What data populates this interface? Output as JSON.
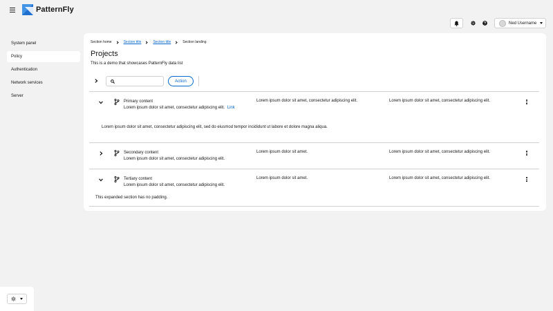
{
  "brand": {
    "name": "PatternFly"
  },
  "header": {
    "user_name": "Ned Username"
  },
  "sidebar": {
    "items": [
      {
        "label": "System panel"
      },
      {
        "label": "Policy"
      },
      {
        "label": "Authentication"
      },
      {
        "label": "Network services"
      },
      {
        "label": "Server"
      }
    ]
  },
  "breadcrumb": {
    "items": [
      {
        "label": "Section home"
      },
      {
        "label": "Section title"
      },
      {
        "label": "Section title"
      },
      {
        "label": "Section landing"
      }
    ]
  },
  "page": {
    "title": "Projects",
    "description": "This is a demo that showcases PatternFly data list"
  },
  "toolbar": {
    "search_placeholder": "",
    "action_label": "Action"
  },
  "rows": [
    {
      "title": "Primary content",
      "subtitle": "Lorem ipsum dolor sit amet, consectetur adipiscing elit.",
      "link": "Link",
      "col2": "Lorem ipsum dolor sit amet, consectetur adipiscing elit.",
      "col3": "Lorem ipsum dolor sit amet, consectetur adipiscing elit.",
      "expanded": "Lorem ipsum dolor sit amet, consectetur adipiscing elit, sed do eiusmod tempor incididunt ut labore et dolore magna aliqua."
    },
    {
      "title": "Secondary content",
      "subtitle": "Lorem ipsum dolor sit amet, consectetur adipiscing elit.",
      "col2": "Lorem ipsum dolor sit amet.",
      "col3": "Lorem ipsum dolor sit amet, consectetur adipiscing elit."
    },
    {
      "title": "Tertiary content",
      "subtitle": "Lorem ipsum dolor sit amet, consectetur adipiscing elit.",
      "col2": "Lorem ipsum dolor sit amet.",
      "col3": "Lorem ipsum dolor sit amet, consectetur adipiscing elit.",
      "expanded": "This expanded section has no padding."
    }
  ],
  "colors": {
    "accent": "#0066cc",
    "background": "#f2f2f2",
    "surface": "#ffffff",
    "border": "#d2d2d2"
  },
  "icons": [
    "menu-icon",
    "bell-icon",
    "gear-icon",
    "help-icon",
    "caret-down-icon",
    "chevron-right-icon",
    "chevron-down-icon",
    "search-icon",
    "code-branch-icon",
    "kebab-icon",
    "theme-icon"
  ]
}
